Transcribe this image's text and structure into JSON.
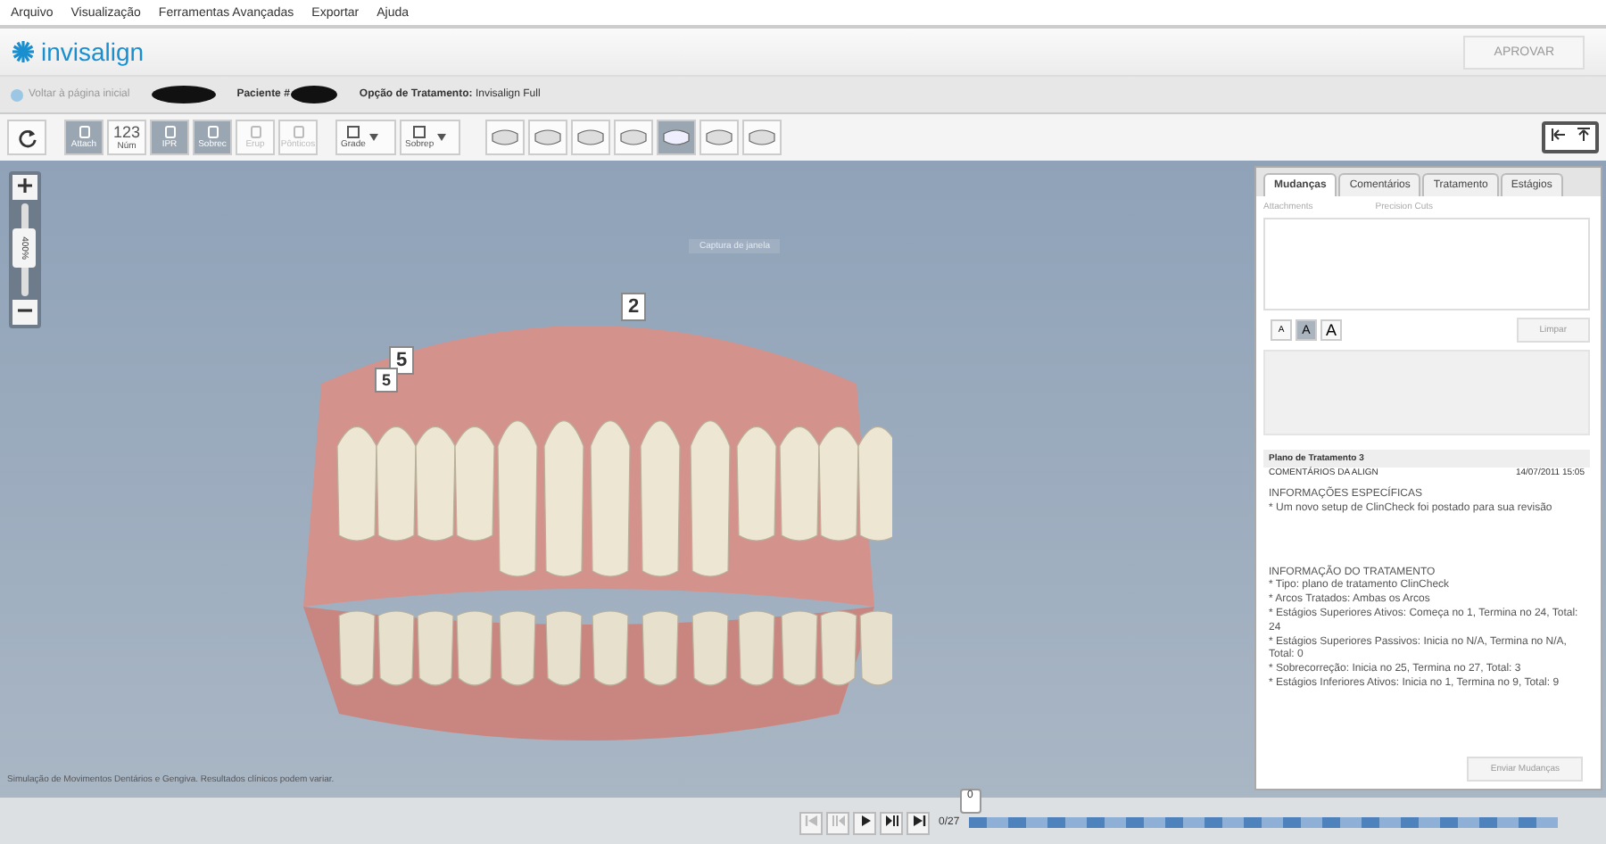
{
  "menu": [
    "Arquivo",
    "Visualização",
    "Ferramentas Avançadas",
    "Exportar",
    "Ajuda"
  ],
  "brand": {
    "name": "invisalign"
  },
  "header": {
    "approve": "APROVAR",
    "back": "Voltar à página inicial",
    "patient_label": "Paciente #",
    "treatment_label": "Opção de Tratamento:",
    "treatment_value": "Invisalign Full"
  },
  "toolbar": [
    {
      "kind": "icon",
      "label": "Attach",
      "selected": true,
      "disabled": false
    },
    {
      "kind": "num",
      "label": "Núm",
      "glyph": "123",
      "selected": false,
      "disabled": false
    },
    {
      "kind": "icon",
      "label": "IPR",
      "selected": true,
      "disabled": false
    },
    {
      "kind": "icon",
      "label": "Sobrec",
      "selected": true,
      "disabled": false
    },
    {
      "kind": "icon",
      "label": "Erup",
      "selected": false,
      "disabled": true
    },
    {
      "kind": "icon",
      "label": "Pônticos",
      "selected": false,
      "disabled": true
    },
    {
      "kind": "dropdown",
      "label": "Grade",
      "selected": false,
      "disabled": false
    },
    {
      "kind": "dropdown",
      "label": "Sobrep",
      "selected": false,
      "disabled": false
    }
  ],
  "views": [
    {
      "selected": false
    },
    {
      "selected": false
    },
    {
      "selected": false
    },
    {
      "selected": false
    },
    {
      "selected": true
    },
    {
      "selected": false
    },
    {
      "selected": false
    }
  ],
  "viewport": {
    "zoom": {
      "reading": "400%",
      "level": 0.55
    },
    "capture_hint": "Captura de janela",
    "labels": [
      "2",
      "5",
      "5"
    ],
    "disclaimer": "Simulação de Movimentos Dentários e Gengiva. Resultados clínicos podem variar."
  },
  "panel": {
    "tabs": [
      {
        "label": "Mudanças",
        "selected": true
      },
      {
        "label": "Comentários",
        "selected": false
      },
      {
        "label": "Tratamento",
        "selected": false
      },
      {
        "label": "Estágios",
        "selected": false
      }
    ],
    "subheads": [
      "Attachments",
      "Precision Cuts"
    ],
    "font_sizes": [
      {
        "label": "A",
        "selected": false
      },
      {
        "label": "A",
        "selected": true
      },
      {
        "label": "A",
        "selected": false
      }
    ],
    "clear": "Limpar",
    "comment": {
      "plan": "Plano de Tratamento 3",
      "author": "COMENTÁRIOS DA ALIGN",
      "date": "14/07/2011 15:05",
      "sections": [
        {
          "lines": [
            "INFORMAÇÕES ESPECÍFICAS",
            "* Um novo setup de ClinCheck foi postado para sua revisão"
          ]
        },
        {
          "lines": [
            "INFORMAÇÃO DO TRATAMENTO",
            "* Tipo: plano de tratamento ClinCheck",
            "* Arcos Tratados: Ambas  os Arcos",
            "* Estágios Superiores Ativos: Começa no 1, Termina no 24, Total: 24",
            "* Estágios Superiores Passivos: Inicia no N/A, Termina no N/A, Total: 0",
            "* Sobrecorreção: Inicia no 25, Termina no 27, Total: 3",
            "* Estágios Inferiores Ativos: Inicia no 1, Termina no 9, Total: 9"
          ]
        }
      ]
    },
    "send": "Enviar Mudanças"
  },
  "timeline": {
    "counter": "0/27",
    "handle": "0",
    "level": 0
  }
}
